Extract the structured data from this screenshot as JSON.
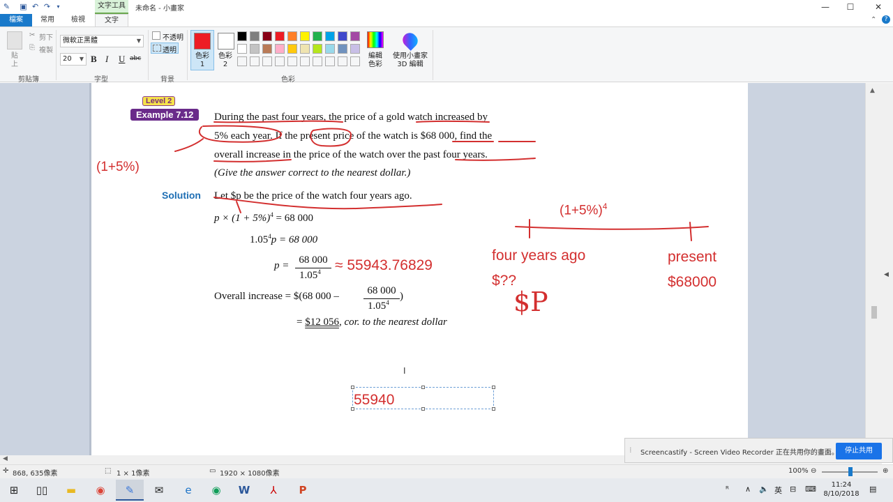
{
  "titlebar": {
    "context_tab": "文字工具",
    "title": "未命名 - 小畫家",
    "controls": {
      "minimize": "—",
      "maximize": "☐",
      "close": "✕"
    }
  },
  "tabs": [
    {
      "label": "檔案"
    },
    {
      "label": "常用"
    },
    {
      "label": "檢視"
    },
    {
      "label": "文字"
    }
  ],
  "ribbon": {
    "clipboard": {
      "paste": "貼上",
      "cut": "剪下",
      "copy": "複製",
      "group": "剪貼簿"
    },
    "font": {
      "family": "微軟正黑體",
      "size": "20",
      "bold": "B",
      "italic": "I",
      "underline": "U",
      "strike": "abc",
      "group": "字型"
    },
    "background": {
      "opaque": "不透明",
      "transparent": "透明",
      "group": "背景"
    },
    "colors": {
      "color1_label": "色彩 1",
      "color2_label": "色彩 2",
      "edit_label": "編輯色彩",
      "paint3d_label": "使用小畫家 3D 編輯",
      "group": "色彩",
      "color1": "#ed1c24",
      "color2": "#ffffff",
      "palette_row1": [
        "#000000",
        "#7f7f7f",
        "#880015",
        "#ed1c24",
        "#ff7f27",
        "#fff200",
        "#22b14c",
        "#00a2e8",
        "#3f48cc",
        "#a349a4"
      ],
      "palette_row2": [
        "#ffffff",
        "#c3c3c3",
        "#b97a57",
        "#ffaec9",
        "#ffc90e",
        "#efe4b0",
        "#b5e61d",
        "#99d9ea",
        "#7092be",
        "#c8bfe7"
      ]
    }
  },
  "document": {
    "level": "Level 2",
    "example": "Example 7.12",
    "problem_line1": "During the past four years, the price of a gold watch increased by",
    "problem_line2": "5% each year. If the present price of the watch is $68 000, find the",
    "problem_line3": "overall increase in the price of the watch over the past four years.",
    "problem_line4": "(Give the answer correct to the nearest dollar.)",
    "solution_label": "Solution",
    "sol1": "Let $p be the price of the watch four years ago.",
    "sol2a": "p × (1 + 5%)",
    "sol2b": "4",
    "sol2c": "= 68 000",
    "sol3a": "1.05",
    "sol3b": "4",
    "sol3c": "p = 68 000",
    "sol4_lhs": "p =",
    "frac_num": "68 000",
    "frac_den_a": "1.05",
    "frac_den_b": "4",
    "sol5a": "Overall increase = $(68 000 –",
    "sol5b": ")",
    "sol6a": "=",
    "sol6b": "$12 056",
    "sol6c": ", cor. to the nearest dollar"
  },
  "annotations": {
    "left_formula": "(1+5%)",
    "approx": "≈ 55943.76829",
    "timeline_label": "(1+5%)",
    "timeline_exp": "4",
    "four_years": "four years ago",
    "unknown": "$??",
    "dollar_p": "$P",
    "present": "present",
    "present_value": "$68000"
  },
  "textbox": {
    "value": "55940"
  },
  "statusbar": {
    "cursor": "868, 635像素",
    "selection": "1 × 1像素",
    "canvas_size": "1920 × 1080像素",
    "zoom": "100%"
  },
  "notification": {
    "message": "Screencastify - Screen Video Recorder 正在共用你的畫面。",
    "stop_button": "停止共用"
  },
  "taskbar": {
    "time": "11:24",
    "date": "8/10/2018",
    "ime": "英"
  }
}
